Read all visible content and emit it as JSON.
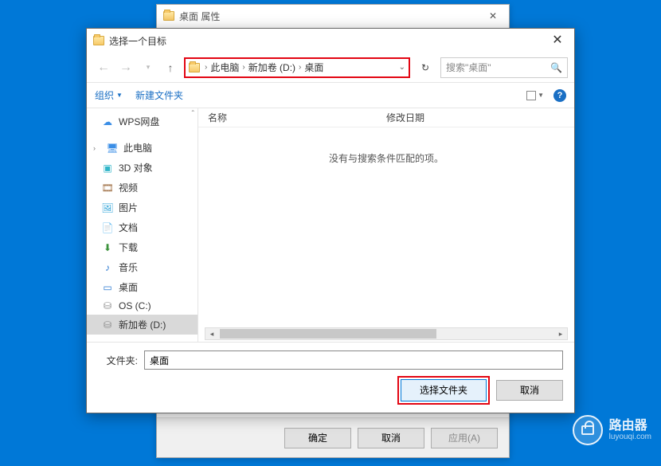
{
  "bg_window": {
    "title": "桌面 属性",
    "buttons": {
      "ok": "确定",
      "cancel": "取消",
      "apply": "应用(A)"
    }
  },
  "dialog": {
    "title": "选择一个目标",
    "breadcrumb": [
      "此电脑",
      "新加卷 (D:)",
      "桌面"
    ],
    "search_placeholder": "搜索\"桌面\"",
    "toolbar": {
      "organize": "组织",
      "new_folder": "新建文件夹"
    },
    "columns": {
      "name": "名称",
      "modified": "修改日期"
    },
    "empty_message": "没有与搜索条件匹配的项。",
    "sidebar": [
      {
        "label": "WPS网盘",
        "icon": "cloud"
      },
      {
        "label": "此电脑",
        "icon": "pc",
        "expandable": true
      },
      {
        "label": "3D 对象",
        "icon": "3d"
      },
      {
        "label": "视频",
        "icon": "video"
      },
      {
        "label": "图片",
        "icon": "pic"
      },
      {
        "label": "文档",
        "icon": "doc"
      },
      {
        "label": "下载",
        "icon": "dl"
      },
      {
        "label": "音乐",
        "icon": "music"
      },
      {
        "label": "桌面",
        "icon": "desk"
      },
      {
        "label": "OS (C:)",
        "icon": "drive"
      },
      {
        "label": "新加卷 (D:)",
        "icon": "drive",
        "active": true
      }
    ],
    "folder_label": "文件夹:",
    "folder_value": "桌面",
    "buttons": {
      "select": "选择文件夹",
      "cancel": "取消"
    }
  },
  "watermark": {
    "title": "路由器",
    "sub": "luyouqi.com"
  }
}
